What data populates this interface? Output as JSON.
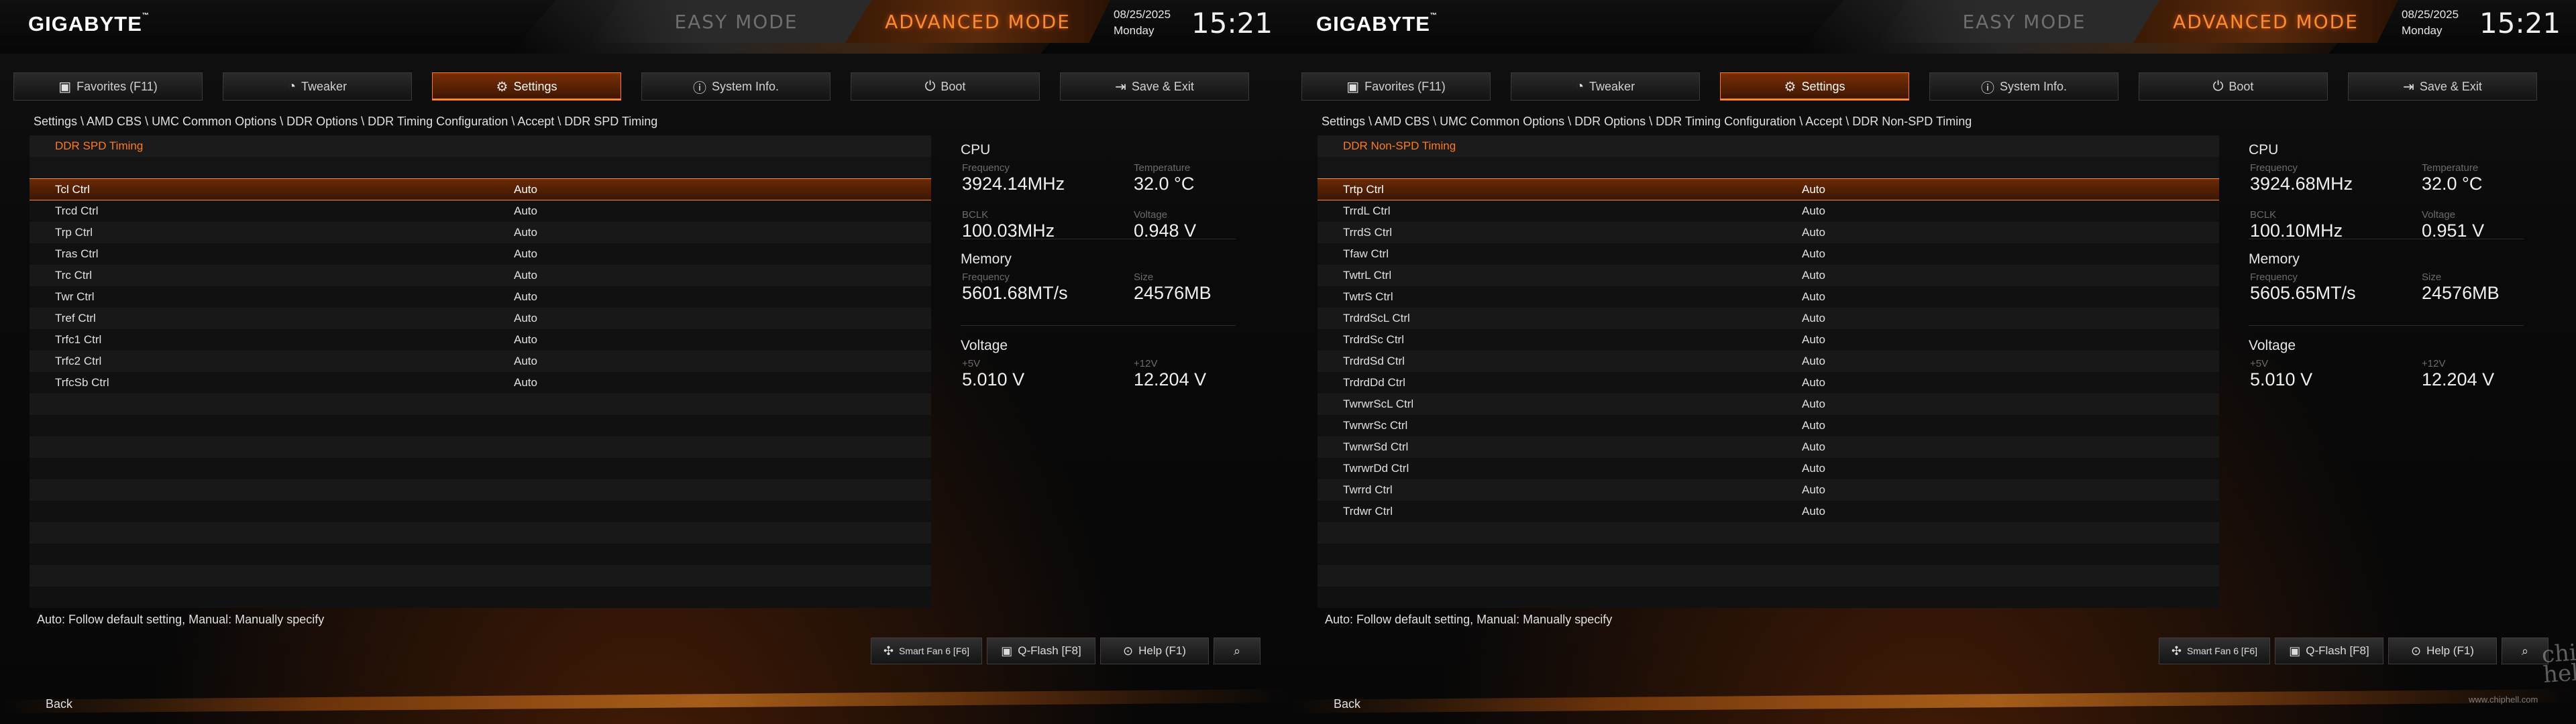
{
  "screens": {
    "left": {
      "logo": "GIGABYTE",
      "logo_tm": "™",
      "easy_mode": "EASY MODE",
      "advanced_mode": "ADVANCED MODE",
      "date": "08/25/2025",
      "day": "Monday",
      "time": "15:21",
      "tabs": [
        {
          "label": "Favorites (F11)",
          "icon": "star-folder-icon"
        },
        {
          "label": "Tweaker",
          "icon": "speedometer-icon"
        },
        {
          "label": "Settings",
          "icon": "gear-icon"
        },
        {
          "label": "System Info.",
          "icon": "info-icon"
        },
        {
          "label": "Boot",
          "icon": "power-icon"
        },
        {
          "label": "Save & Exit",
          "icon": "exit-icon"
        }
      ],
      "active_tab": "Settings",
      "breadcrumb": "Settings  \\  AMD CBS  \\  UMC Common Options  \\  DDR Options  \\  DDR Timing Configuration  \\  Accept  \\  DDR SPD Timing",
      "section_header": "DDR SPD Timing",
      "rows": [
        {
          "name": "Tcl Ctrl",
          "value": "Auto"
        },
        {
          "name": "Trcd Ctrl",
          "value": "Auto"
        },
        {
          "name": "Trp Ctrl",
          "value": "Auto"
        },
        {
          "name": "Tras Ctrl",
          "value": "Auto"
        },
        {
          "name": "Trc Ctrl",
          "value": "Auto"
        },
        {
          "name": "Twr Ctrl",
          "value": "Auto"
        },
        {
          "name": "Tref Ctrl",
          "value": "Auto"
        },
        {
          "name": "Trfc1 Ctrl",
          "value": "Auto"
        },
        {
          "name": "Trfc2 Ctrl",
          "value": "Auto"
        },
        {
          "name": "TrfcSb Ctrl",
          "value": "Auto"
        }
      ],
      "help_text": "Auto: Follow default setting, Manual: Manually specify",
      "monitor": {
        "cpu_title": "CPU",
        "cpu_freq_label": "Frequency",
        "cpu_freq": "3924.14MHz",
        "cpu_temp_label": "Temperature",
        "cpu_temp": "32.0 °C",
        "bclk_label": "BCLK",
        "bclk": "100.03MHz",
        "vcore_label": "Voltage",
        "vcore": "0.948 V",
        "mem_title": "Memory",
        "mem_freq_label": "Frequency",
        "mem_freq": "5601.68MT/s",
        "mem_size_label": "Size",
        "mem_size": "24576MB",
        "volt_title": "Voltage",
        "p5v_label": "+5V",
        "p5v": "5.010 V",
        "p12v_label": "+12V",
        "p12v": "12.204 V"
      },
      "buttons": {
        "smart_fan": "Smart Fan 6 [F6]",
        "qflash": "Q-Flash [F8]",
        "help": "Help (F1)"
      },
      "back": "Back"
    },
    "right": {
      "logo": "GIGABYTE",
      "logo_tm": "™",
      "easy_mode": "EASY MODE",
      "advanced_mode": "ADVANCED MODE",
      "date": "08/25/2025",
      "day": "Monday",
      "time": "15:21",
      "tabs": [
        {
          "label": "Favorites (F11)",
          "icon": "star-folder-icon"
        },
        {
          "label": "Tweaker",
          "icon": "speedometer-icon"
        },
        {
          "label": "Settings",
          "icon": "gear-icon"
        },
        {
          "label": "System Info.",
          "icon": "info-icon"
        },
        {
          "label": "Boot",
          "icon": "power-icon"
        },
        {
          "label": "Save & Exit",
          "icon": "exit-icon"
        }
      ],
      "active_tab": "Settings",
      "breadcrumb": "Settings  \\  AMD CBS  \\  UMC Common Options  \\  DDR Options  \\  DDR Timing Configuration  \\  Accept  \\  DDR Non-SPD Timing",
      "section_header": "DDR Non-SPD Timing",
      "rows": [
        {
          "name": "Trtp Ctrl",
          "value": "Auto"
        },
        {
          "name": "TrrdL Ctrl",
          "value": "Auto"
        },
        {
          "name": "TrrdS Ctrl",
          "value": "Auto"
        },
        {
          "name": "Tfaw Ctrl",
          "value": "Auto"
        },
        {
          "name": "TwtrL Ctrl",
          "value": "Auto"
        },
        {
          "name": "TwtrS Ctrl",
          "value": "Auto"
        },
        {
          "name": "TrdrdScL Ctrl",
          "value": "Auto"
        },
        {
          "name": "TrdrdSc Ctrl",
          "value": "Auto"
        },
        {
          "name": "TrdrdSd Ctrl",
          "value": "Auto"
        },
        {
          "name": "TrdrdDd Ctrl",
          "value": "Auto"
        },
        {
          "name": "TwrwrScL Ctrl",
          "value": "Auto"
        },
        {
          "name": "TwrwrSc Ctrl",
          "value": "Auto"
        },
        {
          "name": "TwrwrSd Ctrl",
          "value": "Auto"
        },
        {
          "name": "TwrwrDd Ctrl",
          "value": "Auto"
        },
        {
          "name": "Twrrd Ctrl",
          "value": "Auto"
        },
        {
          "name": "Trdwr Ctrl",
          "value": "Auto"
        }
      ],
      "help_text": "Auto: Follow default setting, Manual: Manually specify",
      "monitor": {
        "cpu_title": "CPU",
        "cpu_freq_label": "Frequency",
        "cpu_freq": "3924.68MHz",
        "cpu_temp_label": "Temperature",
        "cpu_temp": "32.0 °C",
        "bclk_label": "BCLK",
        "bclk": "100.10MHz",
        "vcore_label": "Voltage",
        "vcore": "0.951 V",
        "mem_title": "Memory",
        "mem_freq_label": "Frequency",
        "mem_freq": "5605.65MT/s",
        "mem_size_label": "Size",
        "mem_size": "24576MB",
        "volt_title": "Voltage",
        "p5v_label": "+5V",
        "p5v": "5.010 V",
        "p12v_label": "+12V",
        "p12v": "12.204 V"
      },
      "buttons": {
        "smart_fan": "Smart Fan 6 [F6]",
        "qflash": "Q-Flash [F8]",
        "help": "Help (F1)"
      },
      "back": "Back",
      "watermark": "chip hell",
      "watermark_url": "www.chiphell.com"
    }
  },
  "colors": {
    "accent": "#ff7a1a",
    "active_tab_bg": "#7a2f06",
    "background": "#0a0a0a",
    "text": "#e0e0e0",
    "muted_label": "#6b6b6b"
  }
}
